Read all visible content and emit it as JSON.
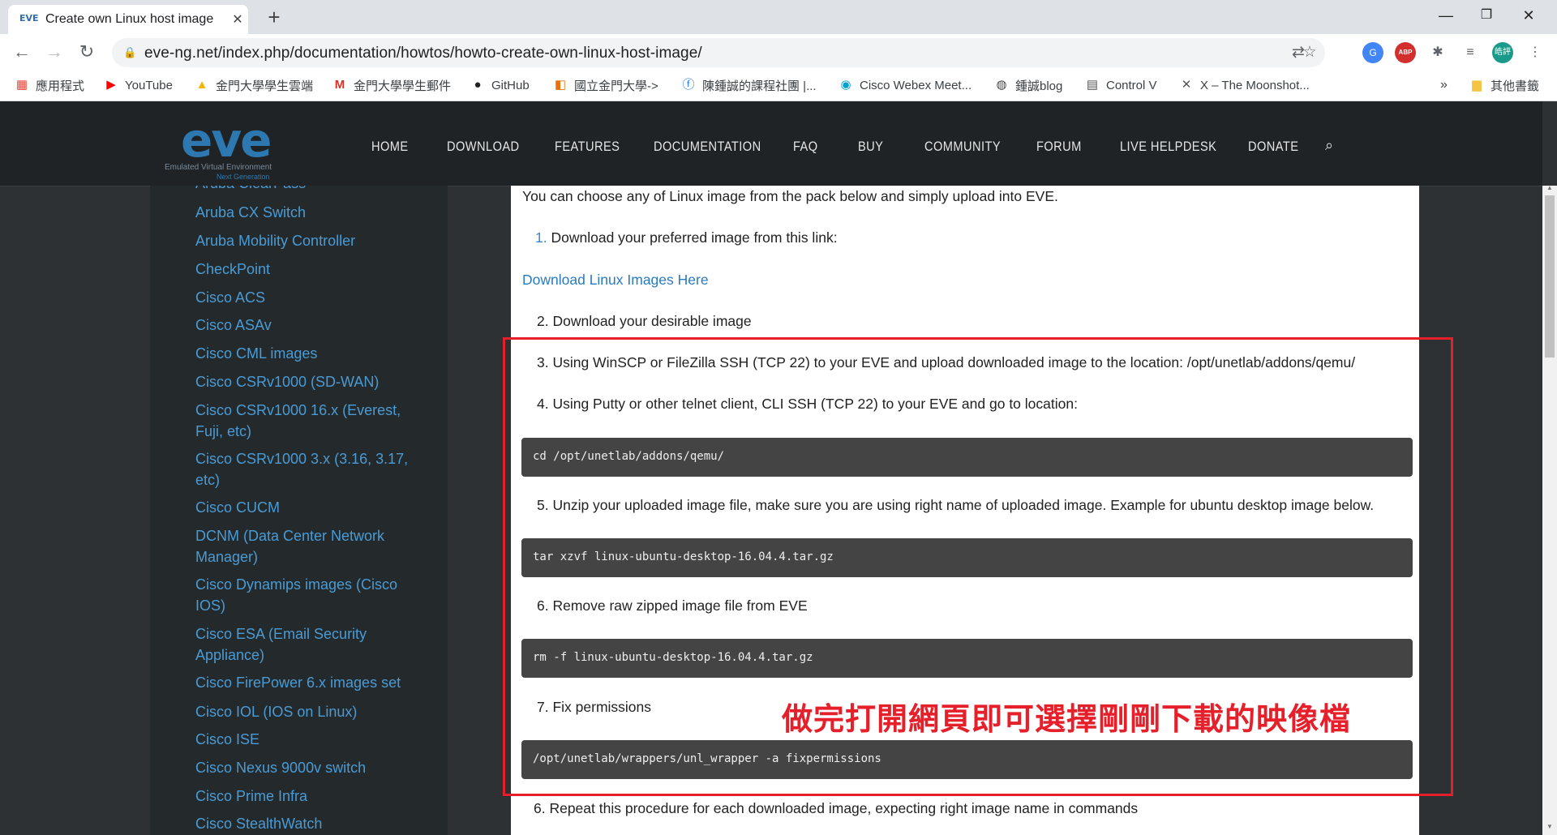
{
  "browser": {
    "tab_title": "Create own Linux host image",
    "tab_favicon": "EVE",
    "url": "eve-ng.net/index.php/documentation/howtos/howto-create-own-linux-host-image/",
    "profile_initials": "皓評",
    "abp_label": "ABP",
    "bookmarks": [
      {
        "label": "應用程式",
        "icon": "apps-grid-icon"
      },
      {
        "label": "YouTube",
        "icon": "youtube-icon"
      },
      {
        "label": "金門大學學生雲端",
        "icon": "drive-icon"
      },
      {
        "label": "金門大學學生郵件",
        "icon": "gmail-icon"
      },
      {
        "label": "GitHub",
        "icon": "github-icon"
      },
      {
        "label": "國立金門大學->",
        "icon": "school-icon"
      },
      {
        "label": "陳鍾誠的課程社團 |...",
        "icon": "facebook-icon"
      },
      {
        "label": "Cisco Webex Meet...",
        "icon": "webex-icon"
      },
      {
        "label": "鍾誠blog",
        "icon": "globe-icon"
      },
      {
        "label": "Control V",
        "icon": "clipboard-icon"
      },
      {
        "label": "X – The Moonshot...",
        "icon": "x-icon"
      }
    ],
    "bookmarks_overflow": "»",
    "other_bookmarks": "其他書籤"
  },
  "site": {
    "logo_text": "eve",
    "logo_sub": "Emulated Virtual Environment",
    "logo_sub2": "Next Generation",
    "menu": [
      "HOME",
      "DOWNLOAD",
      "FEATURES",
      "DOCUMENTATION",
      "FAQ",
      "BUY",
      "COMMUNITY",
      "FORUM",
      "LIVE HELPDESK",
      "DONATE"
    ]
  },
  "sidebar": {
    "partial_top": "Aruba ClearPass",
    "items": [
      "Aruba CX Switch",
      "Aruba Mobility Controller",
      "CheckPoint",
      "Cisco ACS",
      "Cisco ASAv",
      "Cisco CML images",
      "Cisco CSRv1000 (SD-WAN)",
      "Cisco CSRv1000 16.x (Everest, Fuji, etc)",
      "Cisco CSRv1000 3.x (3.16, 3.17, etc)",
      "Cisco CUCM",
      "DCNM (Data Center Network Manager)",
      "Cisco Dynamips images (Cisco IOS)",
      "Cisco ESA (Email Security Appliance)",
      "Cisco FirePower 6.x images set",
      "Cisco IOL (IOS on Linux)",
      "Cisco ISE",
      "Cisco Nexus 9000v switch",
      "Cisco Prime Infra",
      "Cisco StealthWatch"
    ]
  },
  "content": {
    "intro": "You can choose any of Linux image from the pack below and simply upload into EVE.",
    "step1_num": "1.",
    "step1": "Download your preferred image from this link:",
    "download_link": "Download Linux Images Here",
    "step2": "2. Download your desirable image",
    "step3": "3. Using WinSCP or FileZilla SSH (TCP 22) to your EVE and upload downloaded image to the location: /opt/unetlab/addons/qemu/",
    "step4": "4. Using Putty or other telnet client, CLI SSH (TCP 22) to your EVE and go to location:",
    "code1": "cd /opt/unetlab/addons/qemu/",
    "step5": "5. Unzip your uploaded image file, make sure you are using right name of uploaded image. Example for ubuntu desktop image below.",
    "code2": "tar xzvf linux-ubuntu-desktop-16.04.4.tar.gz",
    "step6": "6. Remove raw zipped image file from EVE",
    "code3": "rm -f linux-ubuntu-desktop-16.04.4.tar.gz",
    "step7": "7. Fix permissions",
    "code4": "/opt/unetlab/wrappers/unl_wrapper -a fixpermissions",
    "step8": "6. Repeat this procedure for each downloaded image, expecting right image name in commands",
    "annotation": "做完打開網頁即可選擇剛剛下載的映像檔"
  },
  "colors": {
    "header_bg": "#1f2326",
    "sidebar_link": "#4a9bd4",
    "annotation_red": "#e5202a",
    "code_bg": "#444444"
  }
}
